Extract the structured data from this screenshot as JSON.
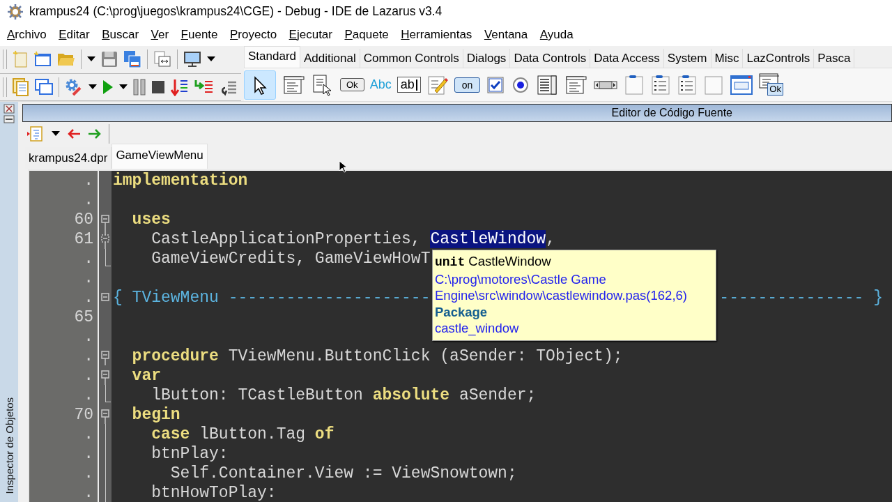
{
  "window": {
    "title": "krampus24 (C:\\prog\\juegos\\krampus24\\CGE) - Debug - IDE de Lazarus v3.4"
  },
  "menu": [
    "Archivo",
    "Editar",
    "Buscar",
    "Ver",
    "Fuente",
    "Proyecto",
    "Ejecutar",
    "Paquete",
    "Herramientas",
    "Ventana",
    "Ayuda"
  ],
  "palette": {
    "tabs": [
      {
        "label": "Standard",
        "selected": true
      },
      {
        "label": "Additional",
        "selected": false
      },
      {
        "label": "Common Controls",
        "selected": false
      },
      {
        "label": "Dialogs",
        "selected": false
      },
      {
        "label": "Data Controls",
        "selected": false
      },
      {
        "label": "Data Access",
        "selected": false
      },
      {
        "label": "System",
        "selected": false
      },
      {
        "label": "Misc",
        "selected": false
      },
      {
        "label": "LazControls",
        "selected": false
      },
      {
        "label": "Pasca",
        "selected": false
      }
    ],
    "items": [
      {
        "kind": "pointer",
        "selected": true
      },
      {
        "kind": "mainmenu",
        "selected": false
      },
      {
        "kind": "popupmenu",
        "selected": false
      },
      {
        "kind": "button",
        "label": "Ok",
        "selected": false
      },
      {
        "kind": "label",
        "label": "Abc",
        "selected": false
      },
      {
        "kind": "edit",
        "label": "ab",
        "selected": false
      },
      {
        "kind": "memo",
        "selected": false
      },
      {
        "kind": "toggle",
        "label": "on",
        "selected": false
      },
      {
        "kind": "checkbox",
        "selected": false
      },
      {
        "kind": "radio",
        "selected": false
      },
      {
        "kind": "listbox",
        "selected": false
      },
      {
        "kind": "combobox",
        "selected": false
      },
      {
        "kind": "scrollbar",
        "selected": false
      },
      {
        "kind": "groupbox",
        "selected": false
      },
      {
        "kind": "radiogroup",
        "selected": false
      },
      {
        "kind": "checkgroup",
        "selected": false
      },
      {
        "kind": "panel",
        "selected": false
      },
      {
        "kind": "frame",
        "selected": false
      },
      {
        "kind": "actionlist",
        "label": "Ok",
        "selected": false
      }
    ]
  },
  "dock": {
    "label": "Inspector de Objetos"
  },
  "editor": {
    "title": "Editor de Código Fuente",
    "tabs": [
      {
        "label": "krampus24.dpr",
        "selected": false
      },
      {
        "label": "GameViewMenu",
        "selected": true
      }
    ],
    "lines": [
      {
        "number": ".",
        "kind": "plain",
        "segments": [
          {
            "text": "implementation",
            "kind": "keyword"
          }
        ]
      },
      {
        "number": ".",
        "kind": "plain"
      },
      {
        "number": "60",
        "kind": "fold-open",
        "segments": [
          {
            "text": "  uses",
            "kind": "keyword"
          }
        ]
      },
      {
        "number": "61",
        "kind": "fold-dotted",
        "segments": [
          {
            "text": "    CastleApplicationProperties, ",
            "kind": "text"
          },
          {
            "text": "CastleWindow",
            "kind": "selected"
          },
          {
            "text": ",",
            "kind": "text"
          }
        ]
      },
      {
        "number": ".",
        "kind": "fold-end",
        "segments": [
          {
            "text": "    GameViewCredits, GameViewHowT",
            "kind": "text"
          }
        ]
      },
      {
        "number": ".",
        "kind": "plain"
      },
      {
        "number": ".",
        "kind": "fold-single",
        "segments": [
          {
            "text": "{ TViewMenu ---------------------",
            "kind": "comment"
          }
        ],
        "segments_right": [
          {
            "text": "--------------- }",
            "kind": "comment"
          }
        ]
      },
      {
        "number": "65",
        "kind": "plain"
      },
      {
        "number": ".",
        "kind": "plain"
      },
      {
        "number": ".",
        "kind": "fold-open",
        "segments": [
          {
            "text": "  procedure",
            "kind": "keyword"
          },
          {
            "text": " TViewMenu.ButtonClick (aSender: TObject);",
            "kind": "text"
          }
        ]
      },
      {
        "number": ".",
        "kind": "fold-open",
        "segments": [
          {
            "text": "  var",
            "kind": "keyword"
          }
        ]
      },
      {
        "number": ".",
        "kind": "fold-end",
        "segments": [
          {
            "text": "    lButton: TCastleButton ",
            "kind": "text"
          },
          {
            "text": "absolute",
            "kind": "keyword"
          },
          {
            "text": " aSender;",
            "kind": "text"
          }
        ]
      },
      {
        "number": "70",
        "kind": "fold-open",
        "segments": [
          {
            "text": "  begin",
            "kind": "keyword"
          }
        ]
      },
      {
        "number": ".",
        "kind": "fold-line",
        "segments": [
          {
            "text": "    case",
            "kind": "keyword"
          },
          {
            "text": " lButton.Tag ",
            "kind": "text"
          },
          {
            "text": "of",
            "kind": "keyword"
          }
        ]
      },
      {
        "number": ".",
        "kind": "fold-line",
        "segments": [
          {
            "text": "    btnPlay:",
            "kind": "text"
          }
        ]
      },
      {
        "number": ".",
        "kind": "fold-line",
        "segments": [
          {
            "text": "      Self.Container.View := ViewSnowtown;",
            "kind": "text"
          }
        ]
      },
      {
        "number": ".",
        "kind": "fold-line",
        "segments": [
          {
            "text": "    btnHowToPlay:",
            "kind": "text"
          }
        ]
      }
    ],
    "hint": {
      "keyword": "unit",
      "name": "CastleWindow",
      "path_lines": [
        "C:\\prog\\motores\\Castle Game",
        "Engine\\src\\window\\castlewindow.pas(162,6)"
      ],
      "package_label": "Package",
      "package": "castle_window"
    }
  }
}
